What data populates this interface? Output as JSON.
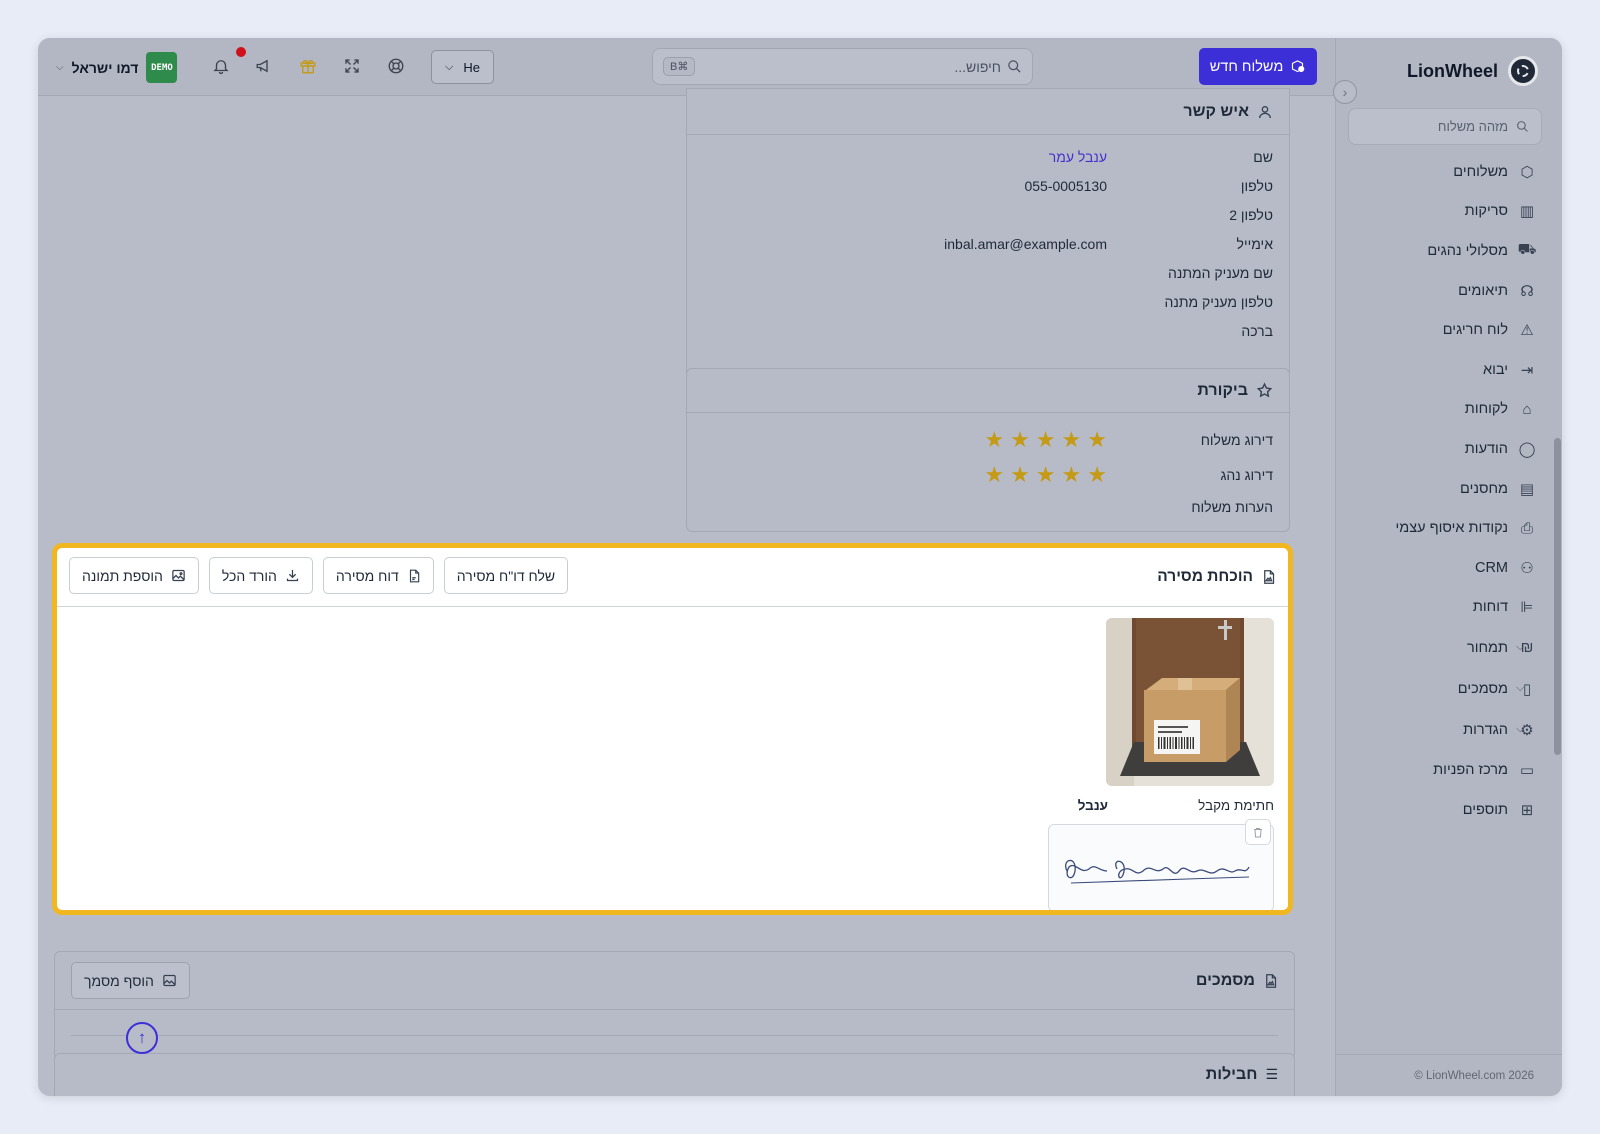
{
  "brand": {
    "name": "LionWheel"
  },
  "sidebar": {
    "search_placeholder": "מזהה משלוח",
    "items": [
      {
        "label": "משלוחים",
        "icon": "package-icon"
      },
      {
        "label": "סריקות",
        "icon": "barcode-icon"
      },
      {
        "label": "מסלולי נהגים",
        "icon": "truck-icon"
      },
      {
        "label": "תיאומים",
        "icon": "headset-icon"
      },
      {
        "label": "לוח חריגים",
        "icon": "warning-icon"
      },
      {
        "label": "יבוא",
        "icon": "import-icon"
      },
      {
        "label": "לקוחות",
        "icon": "bank-icon"
      },
      {
        "label": "הודעות",
        "icon": "chat-icon"
      },
      {
        "label": "מחסנים",
        "icon": "server-icon"
      },
      {
        "label": "נקודות איסוף עצמי",
        "icon": "pickup-icon"
      },
      {
        "label": "CRM",
        "icon": "users-icon"
      },
      {
        "label": "דוחות",
        "icon": "report-icon"
      },
      {
        "label": "תמחור",
        "icon": "pricing-icon",
        "expandable": true
      },
      {
        "label": "מסמכים",
        "icon": "document-icon",
        "expandable": true
      },
      {
        "label": "הגדרות",
        "icon": "settings-icon",
        "expandable": true
      },
      {
        "label": "מרכז הפניות",
        "icon": "ticket-icon"
      },
      {
        "label": "תוספים",
        "icon": "addons-icon"
      }
    ],
    "footer": "LionWheel.com 2026 ©"
  },
  "topbar": {
    "new_delivery": "משלוח חדש",
    "search_placeholder": "חיפוש...",
    "search_shortcut": "⌘B",
    "language": "He",
    "user_name": "דמו ישראל",
    "demo_badge": "DEMO"
  },
  "contact": {
    "title": "איש קשר",
    "rows": [
      {
        "label": "שם",
        "value": "ענבל עמר",
        "link": true
      },
      {
        "label": "טלפון",
        "value": "055-0005130"
      },
      {
        "label": "טלפון 2",
        "value": ""
      },
      {
        "label": "אימייל",
        "value": "inbal.amar@example.com"
      },
      {
        "label": "שם מעניק המתנה",
        "value": ""
      },
      {
        "label": "טלפון מעניק מתנה",
        "value": ""
      },
      {
        "label": "ברכה",
        "value": ""
      }
    ]
  },
  "review": {
    "title": "ביקורת",
    "delivery_rating_label": "דירוג משלוח",
    "delivery_rating": 5,
    "driver_rating_label": "דירוג נהג",
    "driver_rating": 5,
    "notes_label": "הערות משלוח"
  },
  "proof": {
    "title": "הוכחת מסירה",
    "send_report": "שלח דו\"ח מסירה",
    "delivery_report": "דוח מסירה",
    "download_all": "הורד הכל",
    "add_image": "הוספת תמונה",
    "signature_label": "חתימת מקבל",
    "signer_name": "ענבל"
  },
  "documents": {
    "title": "מסמכים",
    "add_document": "הוסף מסמך"
  },
  "next_section": {
    "title": "חבילות"
  },
  "colors": {
    "accent": "#3d2fd8",
    "highlight": "#f0b721",
    "star": "#c49a17"
  }
}
